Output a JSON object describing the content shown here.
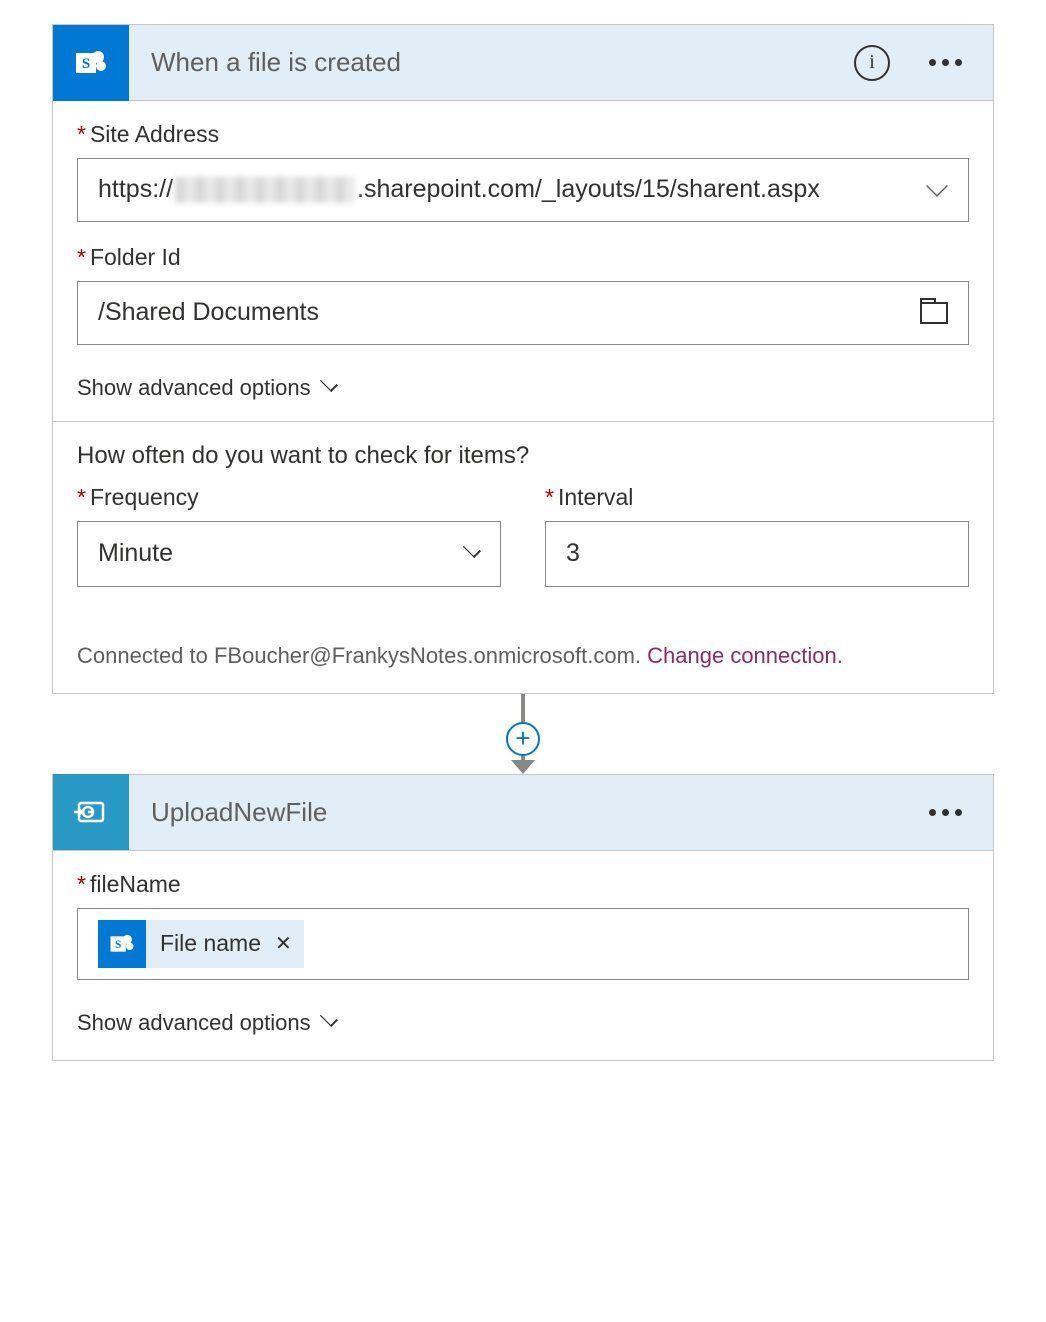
{
  "trigger": {
    "title": "When a file is created",
    "siteAddress": {
      "label": "Site Address",
      "prefix": "https://",
      "suffix": ".sharepoint.com/_layouts/15/sharent.aspx"
    },
    "folderId": {
      "label": "Folder Id",
      "value": "/Shared Documents"
    },
    "showAdvanced": "Show advanced options",
    "polling": {
      "title": "How often do you want to check for items?",
      "frequency": {
        "label": "Frequency",
        "value": "Minute"
      },
      "interval": {
        "label": "Interval",
        "value": "3"
      }
    },
    "connection": {
      "prefix": "Connected to ",
      "account": "FBoucher@FrankysNotes.onmicrosoft.com",
      "suffix": ". ",
      "link": "Change connection."
    }
  },
  "action": {
    "title": "UploadNewFile",
    "fileName": {
      "label": "fileName",
      "tokenLabel": "File name"
    },
    "showAdvanced": "Show advanced options"
  }
}
